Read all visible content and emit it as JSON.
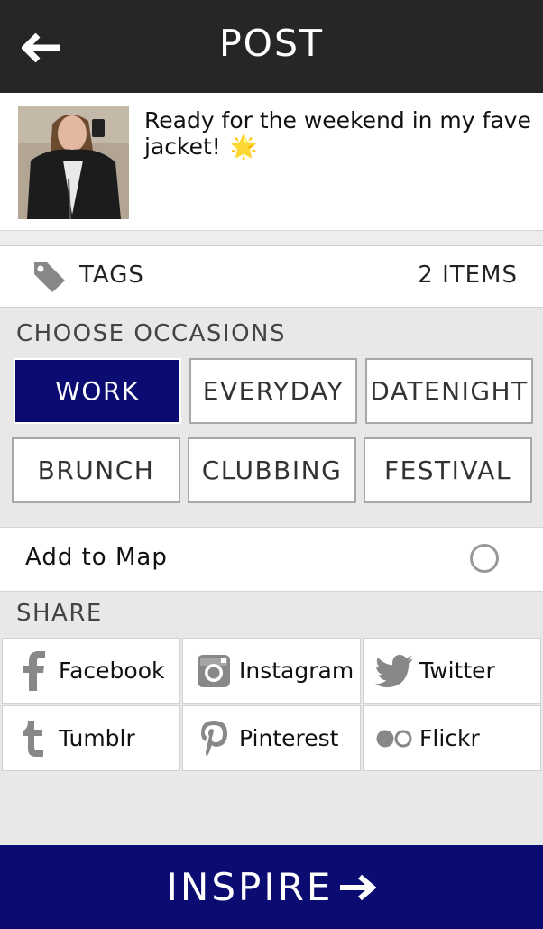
{
  "header": {
    "title": "POST"
  },
  "post": {
    "caption": "Ready for the weekend in my fave jacket!",
    "emoji": "🌟"
  },
  "tags": {
    "label": "TAGS",
    "count": "2 ITEMS"
  },
  "occasions": {
    "title": "CHOOSE OCCASIONS",
    "items": [
      {
        "label": "WORK",
        "selected": true
      },
      {
        "label": "EVERYDAY",
        "selected": false
      },
      {
        "label": "DATENIGHT",
        "selected": false
      },
      {
        "label": "BRUNCH",
        "selected": false
      },
      {
        "label": "CLUBBING",
        "selected": false
      },
      {
        "label": "FESTIVAL",
        "selected": false
      }
    ]
  },
  "map": {
    "label": "Add to Map",
    "checked": false
  },
  "share": {
    "title": "SHARE",
    "items": [
      {
        "label": "Facebook",
        "icon": "facebook-icon"
      },
      {
        "label": "Instagram",
        "icon": "instagram-icon"
      },
      {
        "label": "Twitter",
        "icon": "twitter-icon"
      },
      {
        "label": "Tumblr",
        "icon": "tumblr-icon"
      },
      {
        "label": "Pinterest",
        "icon": "pinterest-icon"
      },
      {
        "label": "Flickr",
        "icon": "flickr-icon"
      }
    ]
  },
  "cta": {
    "label": "INSPIRE"
  },
  "colors": {
    "header_bg": "#262626",
    "accent": "#0b0c72",
    "icon_gray": "#888888"
  }
}
